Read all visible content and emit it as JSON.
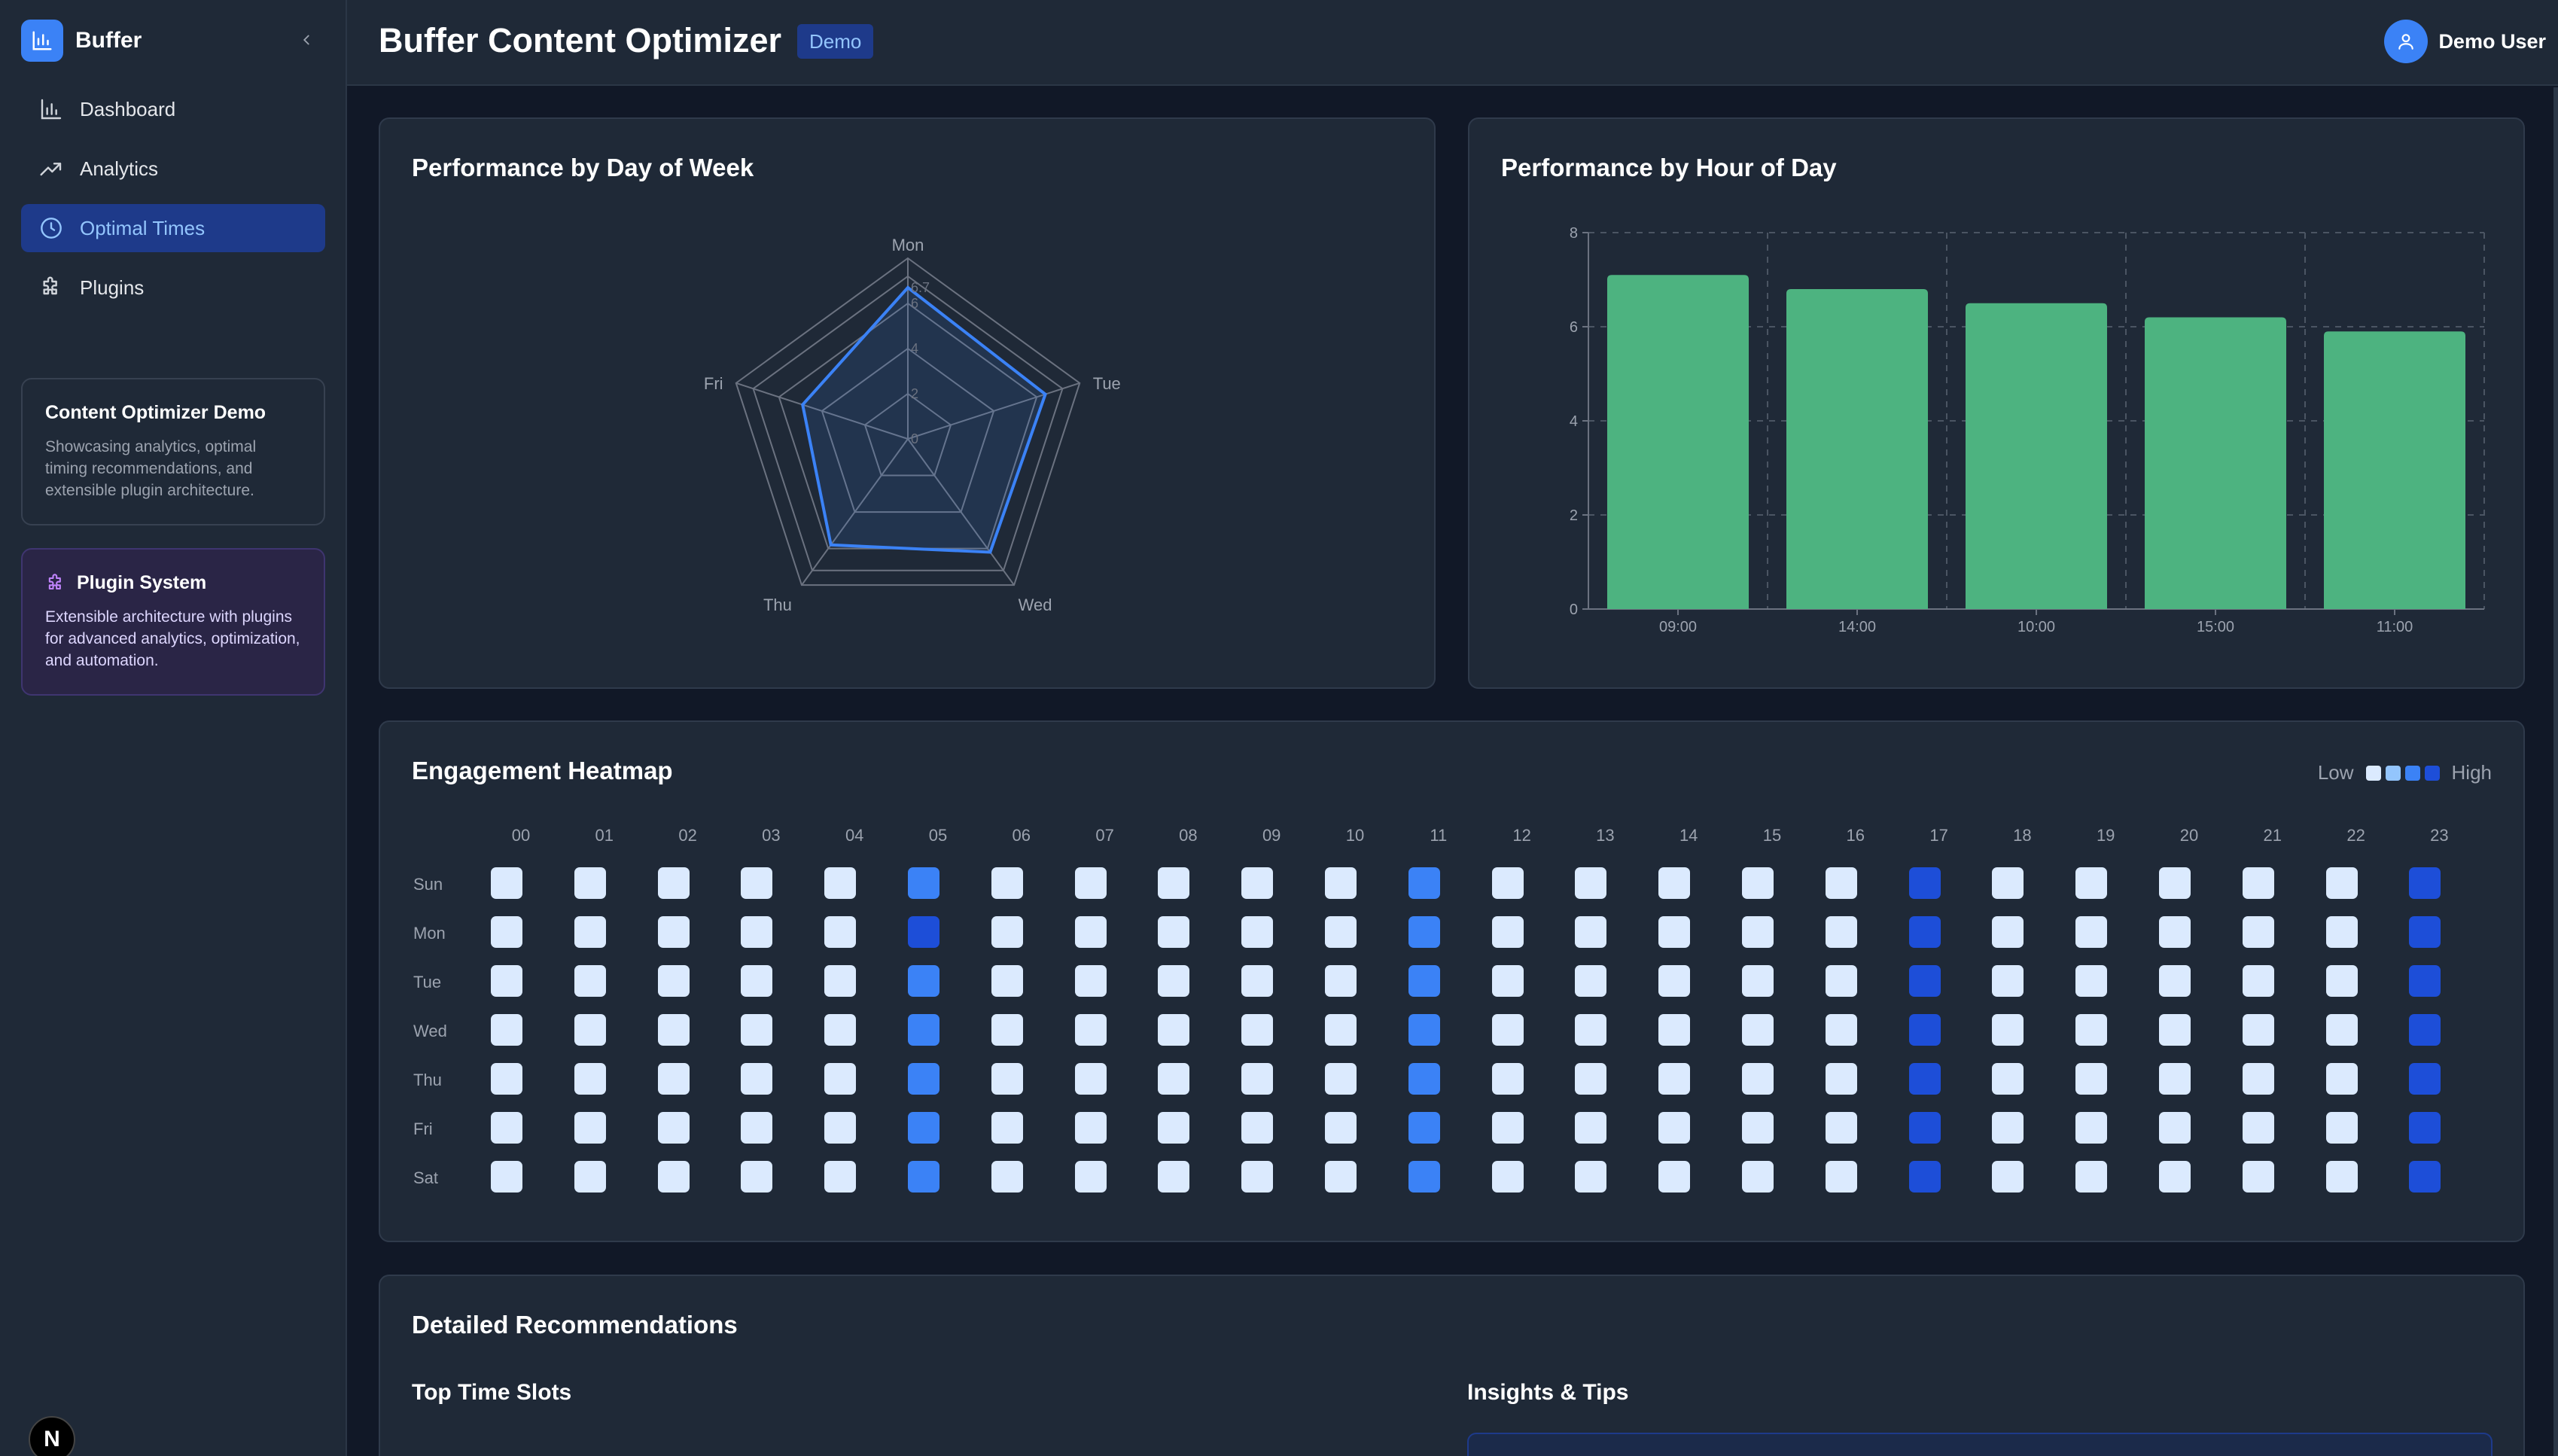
{
  "app": {
    "brand": "Buffer",
    "title": "Buffer Content Optimizer",
    "badge": "Demo",
    "user": "Demo User"
  },
  "sidebar": {
    "items": [
      {
        "label": "Dashboard",
        "icon": "bar-chart-icon",
        "active": false
      },
      {
        "label": "Analytics",
        "icon": "trending-up-icon",
        "active": false
      },
      {
        "label": "Optimal Times",
        "icon": "clock-icon",
        "active": true
      },
      {
        "label": "Plugins",
        "icon": "puzzle-icon",
        "active": false
      }
    ],
    "demo_card": {
      "title": "Content Optimizer Demo",
      "desc": "Showcasing analytics, optimal timing recommendations, and extensible plugin architecture."
    },
    "plugin_card": {
      "title": "Plugin System",
      "desc": "Extensible architecture with plugins for advanced analytics, optimization, and automation."
    },
    "footer_badge": "N"
  },
  "radar": {
    "title": "Performance by Day of Week",
    "chart_data": {
      "type": "radar",
      "categories": [
        "Mon",
        "Tue",
        "Wed",
        "Thu",
        "Fri"
      ],
      "values": [
        6.7,
        6.4,
        6.2,
        5.8,
        4.9
      ],
      "max": 8,
      "ticks": [
        "0",
        "2",
        "4",
        "6",
        "6.7"
      ],
      "color": "#3b82f6"
    }
  },
  "bars": {
    "title": "Performance by Hour of Day",
    "chart_data": {
      "type": "bar",
      "categories": [
        "09:00",
        "14:00",
        "10:00",
        "15:00",
        "11:00"
      ],
      "values": [
        7.1,
        6.8,
        6.5,
        6.2,
        5.9
      ],
      "ylim": [
        0,
        8
      ],
      "yticks": [
        "0",
        "2",
        "4",
        "6",
        "8"
      ],
      "color": "#4db380",
      "grid": true
    }
  },
  "heatmap": {
    "title": "Engagement Heatmap",
    "legend": {
      "low": "Low",
      "high": "High",
      "colors": [
        "#dbeafe",
        "#93c5fd",
        "#3b82f6",
        "#1d4ed8"
      ]
    },
    "hours": [
      "00",
      "01",
      "02",
      "03",
      "04",
      "05",
      "06",
      "07",
      "08",
      "09",
      "10",
      "11",
      "12",
      "13",
      "14",
      "15",
      "16",
      "17",
      "18",
      "19",
      "20",
      "21",
      "22",
      "23"
    ],
    "days": [
      "Sun",
      "Mon",
      "Tue",
      "Wed",
      "Thu",
      "Fri",
      "Sat"
    ],
    "levels": [
      [
        0,
        0,
        0,
        0,
        0,
        2,
        0,
        0,
        0,
        0,
        0,
        2,
        0,
        0,
        0,
        0,
        0,
        3,
        0,
        0,
        0,
        0,
        0,
        3
      ],
      [
        0,
        0,
        0,
        0,
        0,
        3,
        0,
        0,
        0,
        0,
        0,
        2,
        0,
        0,
        0,
        0,
        0,
        3,
        0,
        0,
        0,
        0,
        0,
        3
      ],
      [
        0,
        0,
        0,
        0,
        0,
        2,
        0,
        0,
        0,
        0,
        0,
        2,
        0,
        0,
        0,
        0,
        0,
        3,
        0,
        0,
        0,
        0,
        0,
        3
      ],
      [
        0,
        0,
        0,
        0,
        0,
        2,
        0,
        0,
        0,
        0,
        0,
        2,
        0,
        0,
        0,
        0,
        0,
        3,
        0,
        0,
        0,
        0,
        0,
        3
      ],
      [
        0,
        0,
        0,
        0,
        0,
        2,
        0,
        0,
        0,
        0,
        0,
        2,
        0,
        0,
        0,
        0,
        0,
        3,
        0,
        0,
        0,
        0,
        0,
        3
      ],
      [
        0,
        0,
        0,
        0,
        0,
        2,
        0,
        0,
        0,
        0,
        0,
        2,
        0,
        0,
        0,
        0,
        0,
        3,
        0,
        0,
        0,
        0,
        0,
        3
      ],
      [
        0,
        0,
        0,
        0,
        0,
        2,
        0,
        0,
        0,
        0,
        0,
        2,
        0,
        0,
        0,
        0,
        0,
        3,
        0,
        0,
        0,
        0,
        0,
        3
      ]
    ]
  },
  "recommendations": {
    "title": "Detailed Recommendations",
    "left_title": "Top Time Slots",
    "right_title": "Insights & Tips"
  }
}
